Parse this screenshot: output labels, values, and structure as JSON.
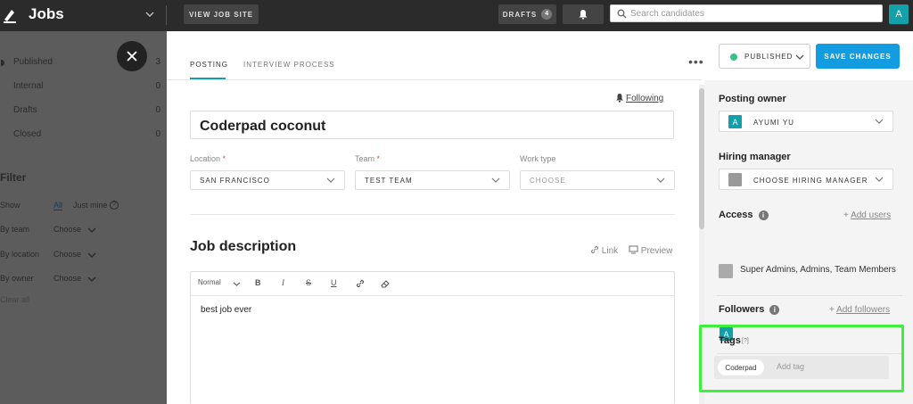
{
  "topbar": {
    "app_title": "Jobs",
    "view_job_site": "VIEW JOB SITE",
    "drafts_label": "DRAFTS",
    "drafts_count": "4",
    "search_placeholder": "Search candidates",
    "avatar_letter": "A"
  },
  "sidebar": {
    "items": [
      {
        "label": "Published",
        "count": "3"
      },
      {
        "label": "Internal",
        "count": "0"
      },
      {
        "label": "Drafts",
        "count": "0"
      },
      {
        "label": "Closed",
        "count": "0"
      }
    ],
    "filter_title": "Filter",
    "show_label": "Show",
    "show_all": "All",
    "show_mine": "Just mine",
    "by_team_label": "By team",
    "by_location_label": "By location",
    "by_owner_label": "By owner",
    "choose": "Choose",
    "clear_all": "Clear all"
  },
  "tabs": {
    "posting": "POSTING",
    "interview": "INTERVIEW PROCESS"
  },
  "header": {
    "more": "•••",
    "status": "PUBLISHED",
    "save": "SAVE CHANGES"
  },
  "posting": {
    "following": "Following",
    "title_value": "Coderpad coconut",
    "location_label": "Location",
    "location_value": "SAN FRANCISCO",
    "team_label": "Team",
    "team_value": "TEST TEAM",
    "worktype_label": "Work type",
    "worktype_placeholder": "CHOOSE",
    "required_mark": "*",
    "job_description_title": "Job description",
    "link_label": "Link",
    "preview_label": "Preview",
    "editor_format": "Normal",
    "editor_body": "best job ever"
  },
  "right": {
    "posting_owner_title": "Posting owner",
    "owner_avatar": "A",
    "owner_name": "AYUMI YU",
    "hiring_manager_title": "Hiring manager",
    "hiring_manager_placeholder": "CHOOSE HIRING MANAGER",
    "access_title": "Access",
    "add_users": "Add users",
    "access_value": "Super Admins, Admins, Team Members",
    "followers_title": "Followers",
    "add_followers": "Add followers",
    "follower_avatar": "A",
    "tags_title": "Tags",
    "tags_help": "[?]",
    "tag": "Coderpad",
    "add_tag_placeholder": "Add tag",
    "plus": "+",
    "info": "i"
  },
  "colors": {
    "accent": "#13a0a8",
    "primary_button": "#139ce0",
    "published_dot": "#3ac18a",
    "highlight": "#3cf03c"
  }
}
